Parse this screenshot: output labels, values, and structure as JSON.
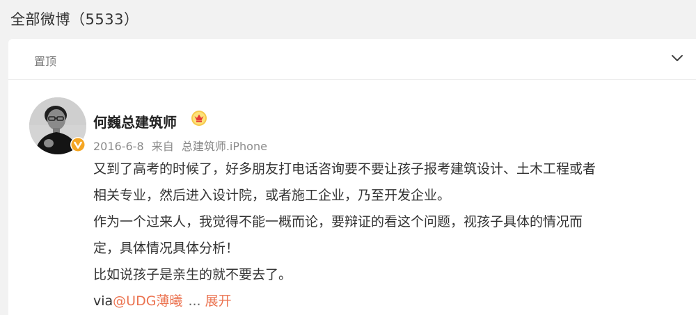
{
  "header": {
    "title": "全部微博（5533）"
  },
  "card": {
    "pin_label": "置顶",
    "chevron_icon": "chevron-down-icon"
  },
  "post": {
    "avatar_icon": "user-avatar",
    "verified_icon": "verified-badge-icon",
    "verified_color": "#f5a623",
    "author": "何巍总建筑师",
    "crown_icon": "crown-icon",
    "date": "2016-6-8",
    "source_prefix": "来自",
    "source": "总建筑师.iPhone",
    "lines": [
      "又到了高考的时候了，好多朋友打电话咨询要不要让孩子报考建筑设计、土木工程或者",
      "相关专业，然后进入设计院，或者施工企业，乃至开发企业。",
      "作为一个过来人，我觉得不能一概而论，要辩证的看这个问题，视孩子具体的情况而",
      "定，具体情况具体分析！",
      "比如说孩子是亲生的就不要去了。"
    ],
    "via_prefix": "via",
    "mention": "@UDG薄曦",
    "ellipsis": "...",
    "expand_label": "展开",
    "link_color": "#eb7350"
  }
}
